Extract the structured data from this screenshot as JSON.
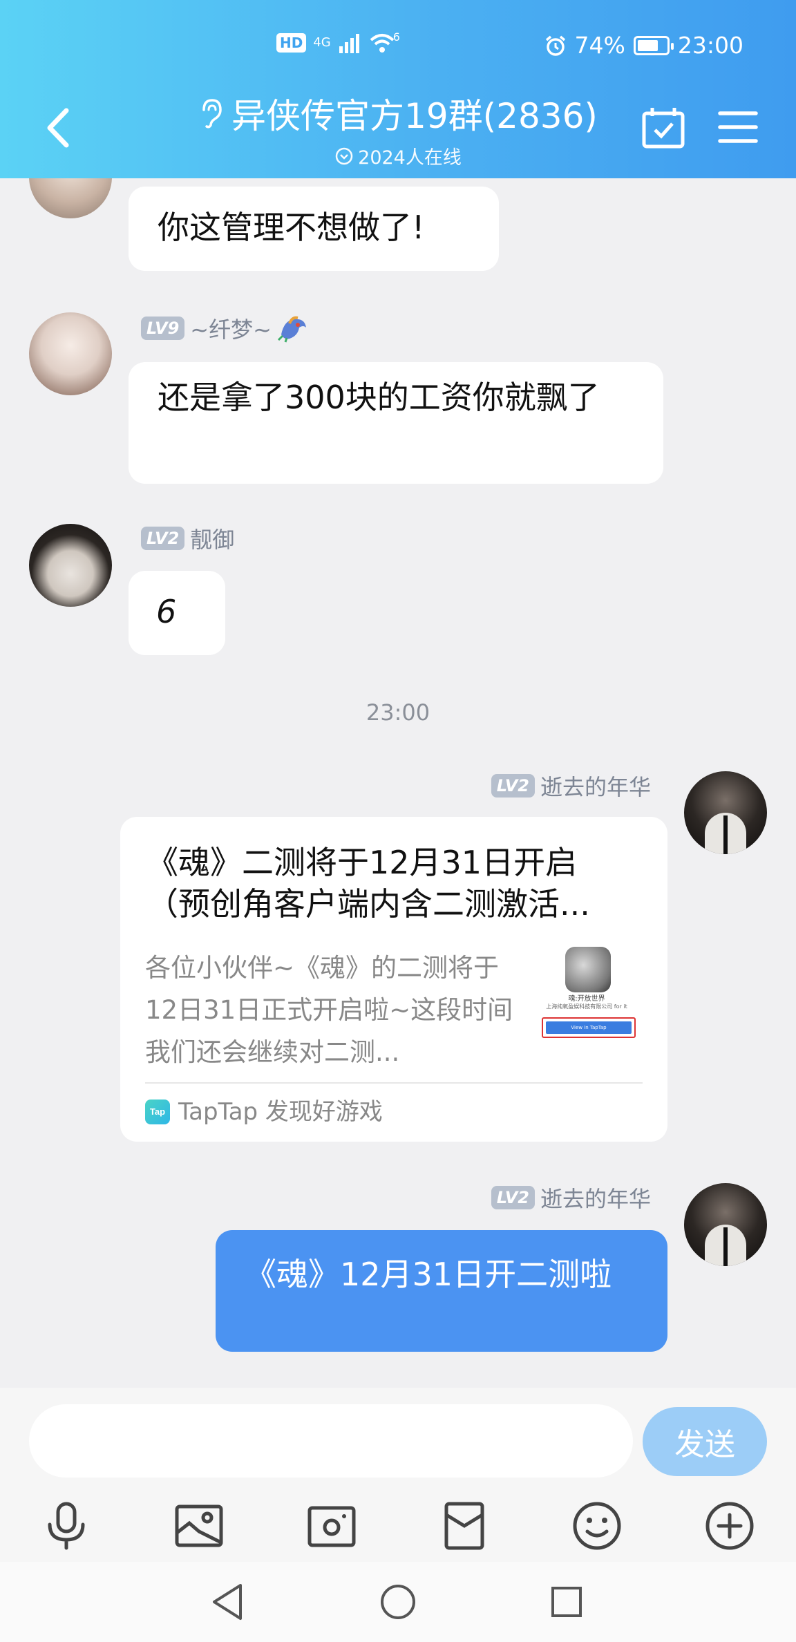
{
  "status_bar": {
    "network_badge": "HD",
    "network_type": "4G",
    "wifi_label": "6",
    "battery": "74%",
    "battery_level": 0.74,
    "time": "23:00"
  },
  "header": {
    "title": "异侠传官方19群(2836)",
    "subtitle": "2024人在线",
    "icons": [
      "back-arrow-icon",
      "ear-icon",
      "calendar-check-icon",
      "menu-icon"
    ]
  },
  "messages": [
    {
      "id": "m1",
      "text": "你这管理不想做了!"
    },
    {
      "id": "m2",
      "level": "LV9",
      "nickname": "~纤梦~",
      "text": "还是拿了300块的工资你就飘了"
    },
    {
      "id": "m3",
      "level": "LV2",
      "nickname": "靓御",
      "text": "6"
    },
    {
      "id": "ts",
      "time": "23:00"
    },
    {
      "id": "m4",
      "level": "LV2",
      "nickname": "逝去的年华",
      "card": {
        "title": "《魂》二测将于12月31日开启（预创角客户端内含二测激活...",
        "description": "各位小伙伴~《魂》的二测将于12日31日正式开启啦~这段时间我们还会继续对二测...",
        "thumb_caption": "魂:开放世界",
        "thumb_company": "上海纯氧盈娱科技有限公司 for it",
        "thumb_button": "View in TapTap",
        "source_logo": "Tap",
        "source": "TapTap 发现好游戏"
      }
    },
    {
      "id": "m5",
      "level": "LV2",
      "nickname": "逝去的年华",
      "text": "《魂》12月31日开二测啦"
    }
  ],
  "input": {
    "placeholder": "",
    "send_label": "发送"
  },
  "toolbar": [
    "microphone-icon",
    "image-icon",
    "camera-icon",
    "red-packet-icon",
    "emoji-icon",
    "plus-icon"
  ],
  "colors": {
    "header_start": "#5bd2f5",
    "header_end": "#3f9cef",
    "self_bubble": "#4b93f2",
    "send_button": "#9ccdf7"
  }
}
